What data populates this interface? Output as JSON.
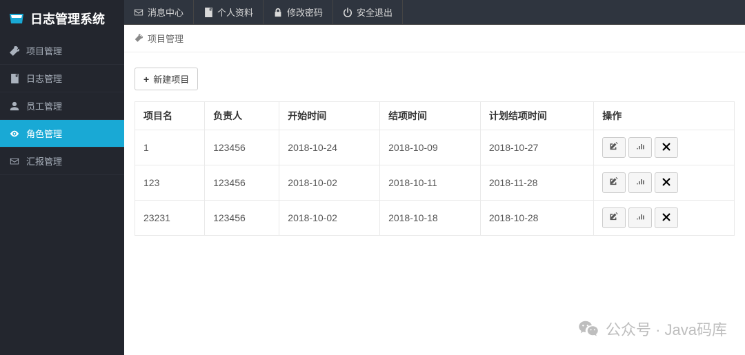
{
  "app": {
    "title": "日志管理系统"
  },
  "sidebar": {
    "items": [
      {
        "label": "项目管理",
        "icon": "wrench"
      },
      {
        "label": "日志管理",
        "icon": "doc"
      },
      {
        "label": "员工管理",
        "icon": "user"
      },
      {
        "label": "角色管理",
        "icon": "eye",
        "active": true
      },
      {
        "label": "汇报管理",
        "icon": "mail"
      }
    ]
  },
  "topbar": {
    "items": [
      {
        "label": "消息中心",
        "icon": "mail"
      },
      {
        "label": "个人资料",
        "icon": "doc"
      },
      {
        "label": "修改密码",
        "icon": "lock"
      },
      {
        "label": "安全退出",
        "icon": "power"
      }
    ]
  },
  "breadcrumb": {
    "label": "项目管理"
  },
  "toolbar": {
    "new_button": "新建项目"
  },
  "table": {
    "columns": [
      "项目名",
      "负责人",
      "开始时间",
      "结项时间",
      "计划结项时间",
      "操作"
    ],
    "rows": [
      {
        "name": "1",
        "owner": "123456",
        "start": "2018-10-24",
        "end": "2018-10-09",
        "plan_end": "2018-10-27"
      },
      {
        "name": "123",
        "owner": "123456",
        "start": "2018-10-02",
        "end": "2018-10-11",
        "plan_end": "2018-11-28"
      },
      {
        "name": "23231",
        "owner": "123456",
        "start": "2018-10-02",
        "end": "2018-10-18",
        "plan_end": "2018-10-28"
      }
    ]
  },
  "watermark": {
    "text": "公众号 · Java码库"
  }
}
